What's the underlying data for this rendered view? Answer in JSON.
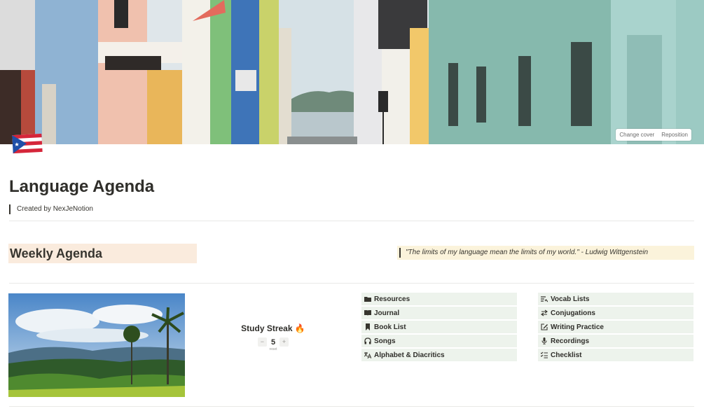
{
  "cover": {
    "change_label": "Change cover",
    "reposition_label": "Reposition"
  },
  "page": {
    "title": "Language Agenda",
    "created_by": "Created by NexJeNotion"
  },
  "weekly": {
    "heading": "Weekly Agenda"
  },
  "quote": {
    "text": "\"The limits of my language mean the limits of my world.\" - Ludwig Wittgenstein"
  },
  "streak": {
    "title": "Study Streak 🔥",
    "value": "5",
    "minus": "−",
    "plus": "+",
    "reset": "reset"
  },
  "links_left": [
    {
      "label": "Resources",
      "icon": "folder-icon"
    },
    {
      "label": "Journal",
      "icon": "book-open-icon"
    },
    {
      "label": "Book List",
      "icon": "bookmark-icon"
    },
    {
      "label": "Songs",
      "icon": "headphones-icon"
    },
    {
      "label": "Alphabet & Diacritics",
      "icon": "translate-icon"
    }
  ],
  "links_right": [
    {
      "label": "Vocab Lists",
      "icon": "list-icon"
    },
    {
      "label": "Conjugations",
      "icon": "swap-icon"
    },
    {
      "label": "Writing Practice",
      "icon": "pencil-square-icon"
    },
    {
      "label": "Recordings",
      "icon": "microphone-icon"
    },
    {
      "label": "Checklist",
      "icon": "checklist-icon"
    }
  ],
  "colors": {
    "weekly_bg": "#faebdd",
    "quote_bg": "#fbf3db",
    "link_bg": "#edf3ec",
    "text": "#37352f"
  }
}
